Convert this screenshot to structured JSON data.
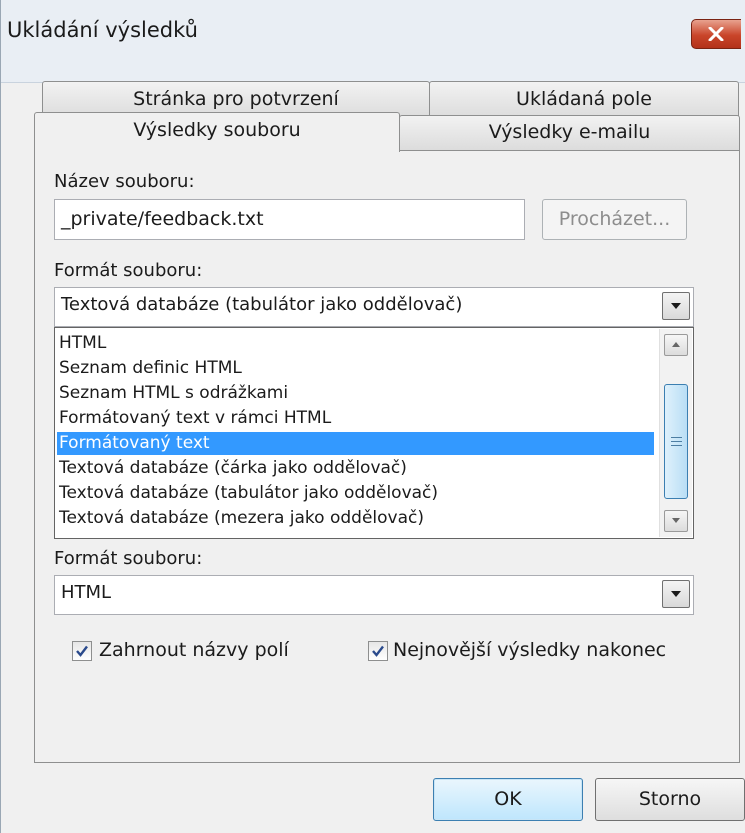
{
  "window": {
    "title": "Ukládání výsledků"
  },
  "tabs": {
    "confirmation": "Stránka pro potvrzení",
    "saved_fields": "Ukládaná pole",
    "file_results": "Výsledky souboru",
    "email_results": "Výsledky e-mailu"
  },
  "file": {
    "name_label": "Název souboru:",
    "name_value": "_private/feedback.txt",
    "browse_label": "Procházet...",
    "format_label": "Formát souboru:",
    "format_value": "Textová databáze (tabulátor jako oddělovač)",
    "format_options": [
      "HTML",
      "Seznam definic HTML",
      "Seznam HTML s odrážkami",
      "Formátovaný text v rámci HTML",
      "Formátovaný text",
      "Textová databáze (čárka jako oddělovač)",
      "Textová databáze (tabulátor jako oddělovač)",
      "Textová databáze (mezera jako oddělovač)"
    ],
    "highlighted_option_index": 4
  },
  "second_format": {
    "label": "Formát souboru:",
    "value": "HTML"
  },
  "options": {
    "include_field_names": {
      "label": "Zahrnout názvy polí",
      "checked": true
    },
    "newest_last": {
      "label": "Nejnovější výsledky nakonec",
      "checked": true
    }
  },
  "footer": {
    "ok_label": "OK",
    "cancel_label": "Storno"
  },
  "colors": {
    "selection": "#3399ff",
    "close_button": "#c9452a"
  }
}
